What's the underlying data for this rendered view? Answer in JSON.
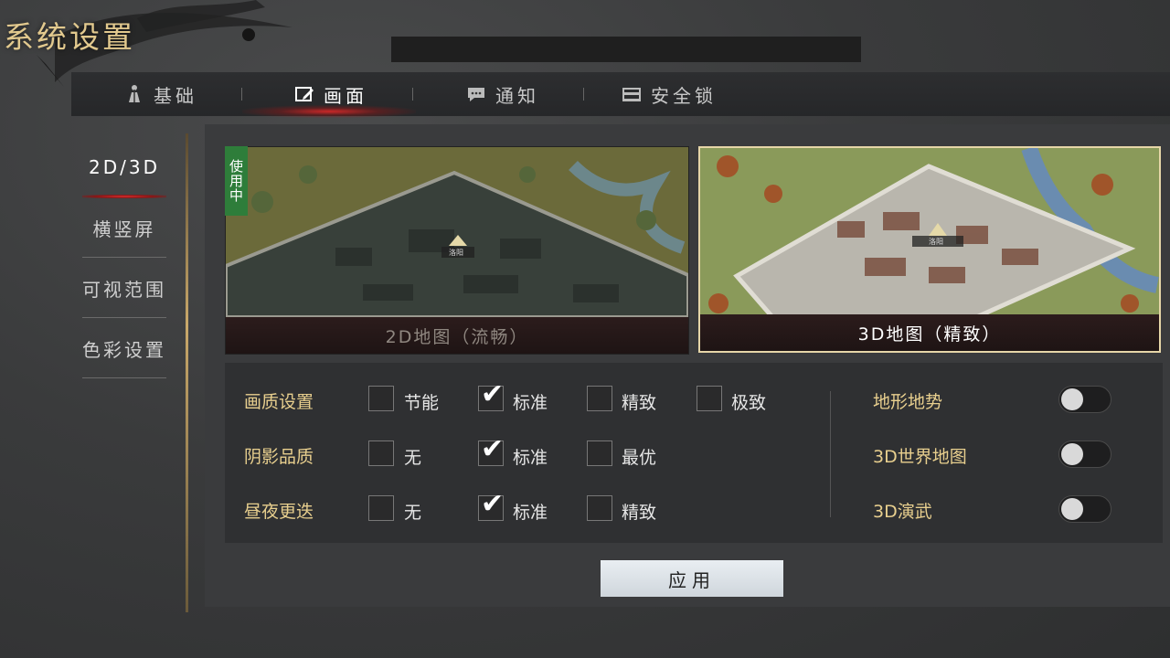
{
  "title": "系统设置",
  "tabs": [
    {
      "label": "基础",
      "icon": "figure-icon"
    },
    {
      "label": "画面",
      "icon": "screen-edit-icon"
    },
    {
      "label": "通知",
      "icon": "chat-bubble-icon"
    },
    {
      "label": "安全锁",
      "icon": "lock-case-icon"
    }
  ],
  "sidebar": {
    "items": [
      {
        "label": "2D/3D"
      },
      {
        "label": "横竖屏"
      },
      {
        "label": "可视范围"
      },
      {
        "label": "色彩设置"
      }
    ]
  },
  "maps": {
    "map2d": {
      "caption": "2D地图（流畅）",
      "city": "洛阳",
      "badge": "使用中"
    },
    "map3d": {
      "caption": "3D地图（精致）",
      "city": "洛阳"
    }
  },
  "settings": {
    "rows": [
      {
        "label": "画质设置",
        "options": [
          "节能",
          "标准",
          "精致",
          "极致"
        ]
      },
      {
        "label": "阴影品质",
        "options": [
          "无",
          "标准",
          "最优"
        ]
      },
      {
        "label": "昼夜更迭",
        "options": [
          "无",
          "标准",
          "精致"
        ]
      }
    ],
    "toggles": [
      {
        "label": "地形地势"
      },
      {
        "label": "3D世界地图"
      },
      {
        "label": "3D演武"
      }
    ]
  },
  "apply_label": "应用",
  "colors": {
    "accent_gold": "#e8cf8e",
    "active_red": "#e03030",
    "inuse_green": "#2e7d3a"
  }
}
